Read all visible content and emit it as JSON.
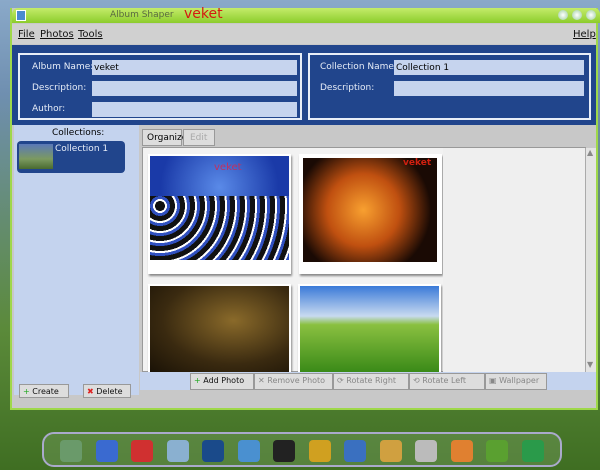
{
  "window": {
    "title": "Album Shaper",
    "album_title": "veket"
  },
  "menu": {
    "file": "File",
    "photos": "Photos",
    "tools": "Tools",
    "help": "Help"
  },
  "album": {
    "name_label": "Album Name:",
    "name_value": "veket",
    "description_label": "Description:",
    "description_value": "",
    "author_label": "Author:",
    "author_value": ""
  },
  "collection": {
    "name_label": "Collection Name:",
    "name_value": "Collection 1",
    "description_label": "Description:",
    "description_value": ""
  },
  "sidebar": {
    "header": "Collections:",
    "items": [
      {
        "label": "Collection 1"
      }
    ],
    "create": "Create",
    "delete": "Delete"
  },
  "tabs": [
    {
      "label": "Organize",
      "active": true
    },
    {
      "label": "Edit",
      "active": false
    }
  ],
  "photos": [
    {
      "name": "penguins",
      "watermark": "veket"
    },
    {
      "name": "cheetah",
      "watermark": "veket"
    },
    {
      "name": "brass-objects"
    },
    {
      "name": "green-hills"
    }
  ],
  "toolbar": {
    "add": "Add Photo",
    "remove": "Remove Photo",
    "rotate_right": "Rotate Right",
    "rotate_left": "Rotate Left",
    "wallpaper": "Wallpaper"
  },
  "dock_icons": [
    "picture-icon",
    "monitor-icon",
    "mascot-icon",
    "notepad-icon",
    "media-icon",
    "network-icon",
    "penguin-icon",
    "contacts-icon",
    "presentation-icon",
    "paint-icon",
    "usb-icon",
    "image-viewer-icon",
    "help-icon",
    "camera-icon"
  ]
}
